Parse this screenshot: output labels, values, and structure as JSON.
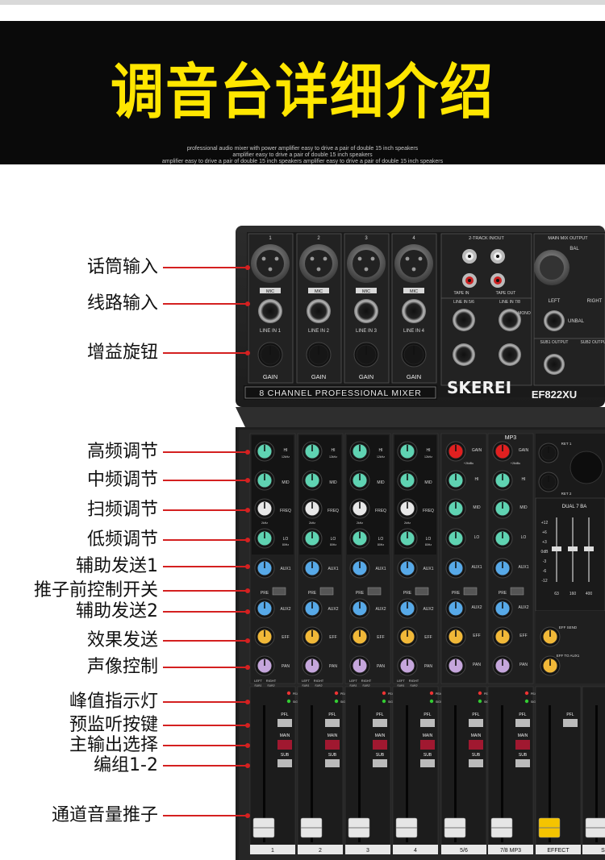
{
  "banner": {
    "title": "调音台详细介绍",
    "subtitle_lines": [
      "professional audio mixer with power amplifier easy to drive a pair of double 15 inch speakers",
      "amplifier easy to drive a pair of double 15 inch speakers",
      "amplifier easy to drive a pair of double 15 inch speakers amplifier easy to drive a pair of double 15 inch speakers"
    ]
  },
  "callouts": [
    "话筒输入",
    "线路输入",
    "增益旋钮",
    "高频调节",
    "中频调节",
    "扫频调节",
    "低频调节",
    "辅助发送1",
    "推子前控制开关",
    "辅助发送2",
    "效果发送",
    "声像控制",
    "峰值指示灯",
    "预监听按键",
    "主输出选择",
    "编组1-2",
    "通道音量推子"
  ],
  "mixer": {
    "brand": "SKEREI",
    "model": "EF822XU",
    "strip_title": "8 CHANNEL PROFESSIONAL MIXER",
    "mono_channel_numbers": [
      "1",
      "2",
      "3",
      "4"
    ],
    "mic_label": "MIC",
    "line_labels": [
      "LINE IN 1",
      "LINE IN 2",
      "LINE IN 3",
      "LINE IN 4"
    ],
    "gain_label": "GAIN",
    "two_track_title": "2-TRACK IN/OUT",
    "tape_in": "TAPE IN",
    "tape_out": "TAPE OUT",
    "line_in_56": "LINE IN 5/6",
    "line_in_78": "LINE IN 7/8",
    "main_mix_output": "MAIN MIX OUTPUT",
    "bal": "BAL",
    "left": "LEFT",
    "unbal": "UNBAL",
    "right": "RIGHT",
    "sub1_output": "SUB1 OUTPUT",
    "sub2_output": "SUB2 OUTPUT",
    "mono": "MONO",
    "mp3": "MP3",
    "eq_labels": [
      "HI",
      "MID",
      "FREQ",
      "LO"
    ],
    "send_labels": [
      "AUX1",
      "PRE",
      "AUX2",
      "EFF",
      "PAN"
    ],
    "stereo_send_labels": [
      "GAIN",
      "HI",
      "MID",
      "LO",
      "AUX1",
      "PRE",
      "AUX2",
      "EFF",
      "PAN"
    ],
    "ret_labels": [
      "RET 1",
      "RET 2"
    ],
    "dual_eq": "DUAL 7 BA",
    "eff_send": "EFF SEND",
    "eff_to_aux1": "EFF TO AUX1",
    "eq_scale": [
      "+12",
      "+6",
      "+3",
      "0dB",
      "-3",
      "-6",
      "-12"
    ],
    "eq_freqs": [
      "63",
      "160",
      "400"
    ],
    "peak": "PEAK",
    "sign": "SIGN",
    "pfl": "PFL",
    "main": "MAIN",
    "sub": "SUB",
    "pan_left": "LEFT",
    "pan_right": "RIGHT",
    "sub12": [
      "SUB1",
      "SUB2"
    ],
    "channel_bottom_labels": [
      "1",
      "2",
      "3",
      "4",
      "5/6",
      "7/8 MP3",
      "EFFECT",
      "SU"
    ],
    "hi_freq": "12kHz",
    "lo_freq": "80Hz",
    "mid_freq": "2kHz",
    "gain_ref": "+26dBu",
    "colors": {
      "hi_knob": "#5fd3b2",
      "mid_knob": "#5fd3b2",
      "freq_knob": "#e8e8e8",
      "lo_knob": "#5fd3b2",
      "aux_knob": "#57a9e8",
      "eff_knob": "#f1b838",
      "pan_knob": "#c5a6dc",
      "gain_knob_stereo": "#e02020",
      "fader_cap": "#e6e6e6",
      "effect_fader_cap": "#f5c400",
      "line_color": "#d42020"
    }
  }
}
